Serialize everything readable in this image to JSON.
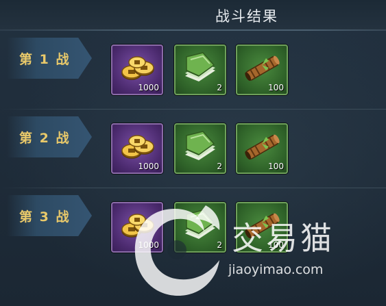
{
  "header": {
    "title": "战斗结果"
  },
  "battles": [
    {
      "label": "第 1 战",
      "rewards": [
        {
          "icon": "gold-coins-icon",
          "count": "1000"
        },
        {
          "icon": "green-book-icon",
          "count": "2"
        },
        {
          "icon": "scroll-icon",
          "count": "100"
        }
      ]
    },
    {
      "label": "第 2 战",
      "rewards": [
        {
          "icon": "gold-coins-icon",
          "count": "1000"
        },
        {
          "icon": "green-book-icon",
          "count": "2"
        },
        {
          "icon": "scroll-icon",
          "count": "100"
        }
      ]
    },
    {
      "label": "第 3 战",
      "rewards": [
        {
          "icon": "gold-coins-icon",
          "count": "1000"
        },
        {
          "icon": "green-book-icon",
          "count": "2"
        },
        {
          "icon": "scroll-icon",
          "count": "100"
        }
      ]
    }
  ],
  "watermark": {
    "brand": "交易猫",
    "url": "jiaoyimao.com"
  },
  "colors": {
    "label_gold": "#e9c96a",
    "slot_purple": "#4b2a6e",
    "slot_green": "#2e6128"
  }
}
